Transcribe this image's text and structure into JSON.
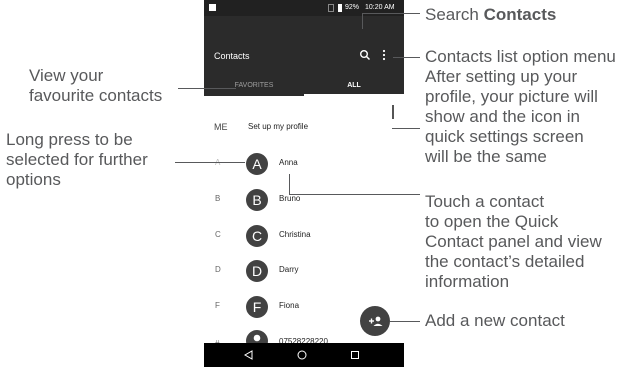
{
  "status_bar": {
    "battery": "92%",
    "time": "10:20 AM"
  },
  "app_bar": {
    "title": "Contacts",
    "tabs": [
      "FAVORITES",
      "ALL"
    ]
  },
  "profile": {
    "label": "ME",
    "text": "Set up my profile"
  },
  "contacts": [
    {
      "letter": "A",
      "initial": "A",
      "name": "Anna"
    },
    {
      "letter": "B",
      "initial": "B",
      "name": "Bruno"
    },
    {
      "letter": "C",
      "initial": "C",
      "name": "Christina"
    },
    {
      "letter": "D",
      "initial": "D",
      "name": "Darry"
    },
    {
      "letter": "F",
      "initial": "F",
      "name": "Fiona"
    },
    {
      "letter": "#",
      "initial": "",
      "name": "07528228220"
    }
  ],
  "annotations": {
    "search_prefix": "Search ",
    "search_bold": "Contacts",
    "view_favourites": [
      "View your",
      "favourite contacts"
    ],
    "long_press": [
      "Long press to be",
      "selected for further",
      "options"
    ],
    "options_menu": [
      "Contacts list option menu",
      "After setting up your",
      "profile, your picture will",
      "show and the icon in",
      "quick settings screen",
      "will be the same"
    ],
    "touch_contact": [
      "Touch a contact",
      "to open the Quick",
      "Contact panel and view",
      "the contact’s detailed",
      "information"
    ],
    "add_contact": "Add a new contact"
  }
}
